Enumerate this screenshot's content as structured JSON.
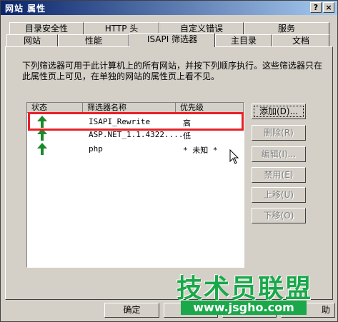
{
  "window": {
    "title": "网站 属性",
    "help_glyph": "?",
    "close_glyph": "×"
  },
  "tabs_row1": [
    "目录安全性",
    "HTTP 头",
    "自定义错误",
    "服务"
  ],
  "tabs_row2": [
    "网站",
    "性能",
    "ISAPI 筛选器",
    "主目录",
    "文档"
  ],
  "active_tab": "ISAPI 筛选器",
  "description": "下列筛选器可用于此计算机上的所有网站，并按下列顺序执行。这些筛选器只在此属性页上可见，在单独的网站的属性页上看不见。",
  "filter_list": {
    "columns": [
      "状态",
      "筛选器名称",
      "优先级"
    ],
    "rows": [
      {
        "status_icon": "green-up-arrow-icon",
        "name": "ISAPI_Rewrite",
        "priority": "高"
      },
      {
        "status_icon": "green-up-arrow-icon",
        "name": "ASP.NET_1.1.4322....",
        "priority": "低"
      },
      {
        "status_icon": "green-up-arrow-icon",
        "name": "php",
        "priority": "* 未知 *"
      }
    ],
    "highlighted_row": 0
  },
  "side_buttons": [
    {
      "label": "添加(D)...",
      "enabled": true
    },
    {
      "label": "删除(R)",
      "enabled": false
    },
    {
      "label": "编辑(I)...",
      "enabled": false
    },
    {
      "label": "禁用(E)",
      "enabled": false
    },
    {
      "label": "上移(U)",
      "enabled": false
    },
    {
      "label": "下移(O)",
      "enabled": false
    }
  ],
  "bottom_buttons": {
    "ok": "确定",
    "partial_right": "助"
  },
  "watermark": {
    "text": "技术员联盟",
    "url": "www.jsgho.com"
  },
  "colors": {
    "highlight": "#e8202a",
    "arrow": "#1a8a2a",
    "watermark": "#1aa84a",
    "titlebar": "#0a246a"
  }
}
